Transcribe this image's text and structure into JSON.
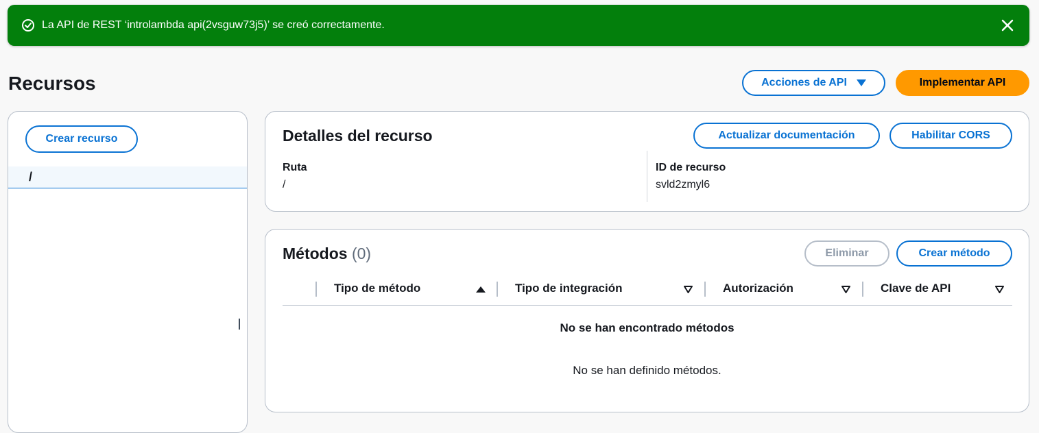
{
  "flash": {
    "message": "La API de REST ‘introlambda api(2vsguw73j5)’ se creó correctamente.",
    "status_icon": "check-circle-icon",
    "close_icon": "close-icon",
    "color": "#037f0c"
  },
  "header": {
    "title": "Recursos",
    "api_actions_label": "Acciones de API",
    "deploy_label": "Implementar API"
  },
  "resources_panel": {
    "create_label": "Crear recurso",
    "tree": [
      {
        "label": "/"
      }
    ]
  },
  "details": {
    "title": "Detalles del recurso",
    "update_docs_label": "Actualizar documentación",
    "enable_cors_label": "Habilitar CORS",
    "path_label": "Ruta",
    "path_value": "/",
    "id_label": "ID de recurso",
    "id_value": "svld2zmyl6"
  },
  "methods": {
    "title": "Métodos",
    "count": "(0)",
    "delete_label": "Eliminar",
    "create_label": "Crear método",
    "columns": [
      "Tipo de método",
      "Tipo de integración",
      "Autorización",
      "Clave de API"
    ],
    "empty_title": "No se han encontrado métodos",
    "empty_desc": "No se han definido métodos."
  },
  "colors": {
    "accent": "#0972d3",
    "primary_button": "#ff9900",
    "success": "#037f0c"
  }
}
